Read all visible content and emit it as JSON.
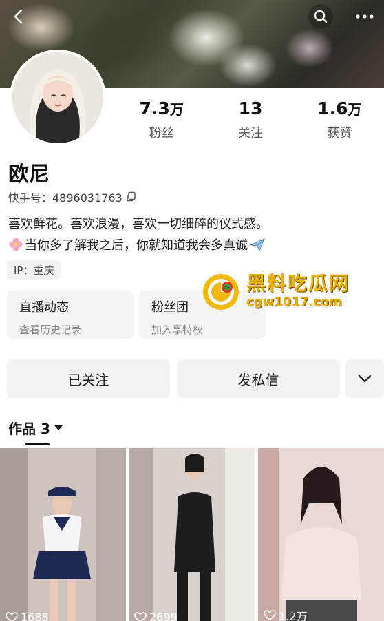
{
  "profile": {
    "name": "欧尼",
    "kuaishou_label": "快手号：4896031763",
    "bio_line1": "喜欢鲜花。喜欢浪漫，喜欢一切细碎的仪式感。",
    "bio_line2": "当你多了解我之后，你就知道我会多真诚",
    "ip_label": "IP：重庆"
  },
  "stats": [
    {
      "value": "7.3",
      "unit": "万",
      "label": "粉丝"
    },
    {
      "value": "13",
      "unit": "",
      "label": "关注"
    },
    {
      "value": "1.6",
      "unit": "万",
      "label": "获赞"
    }
  ],
  "cards": [
    {
      "title": "直播动态",
      "subtitle": "查看历史记录"
    },
    {
      "title": "粉丝团",
      "subtitle": "加入享特权"
    }
  ],
  "actions": {
    "follow_label": "已关注",
    "message_label": "发私信"
  },
  "tabs": {
    "works_label": "作品 3"
  },
  "watermark": {
    "title": "黑料吃瓜网",
    "url": "cgw1017.com"
  },
  "videos": [
    {
      "likes": "1688"
    },
    {
      "likes": "2699"
    },
    {
      "likes": "1.2万"
    }
  ],
  "icons": {
    "back": "back-arrow-icon",
    "search": "search-icon",
    "more": "more-icon",
    "copy": "copy-icon",
    "flower": "flower-icon",
    "plane": "airplane-icon",
    "chevron": "chevron-down-icon",
    "heart": "heart-icon"
  }
}
